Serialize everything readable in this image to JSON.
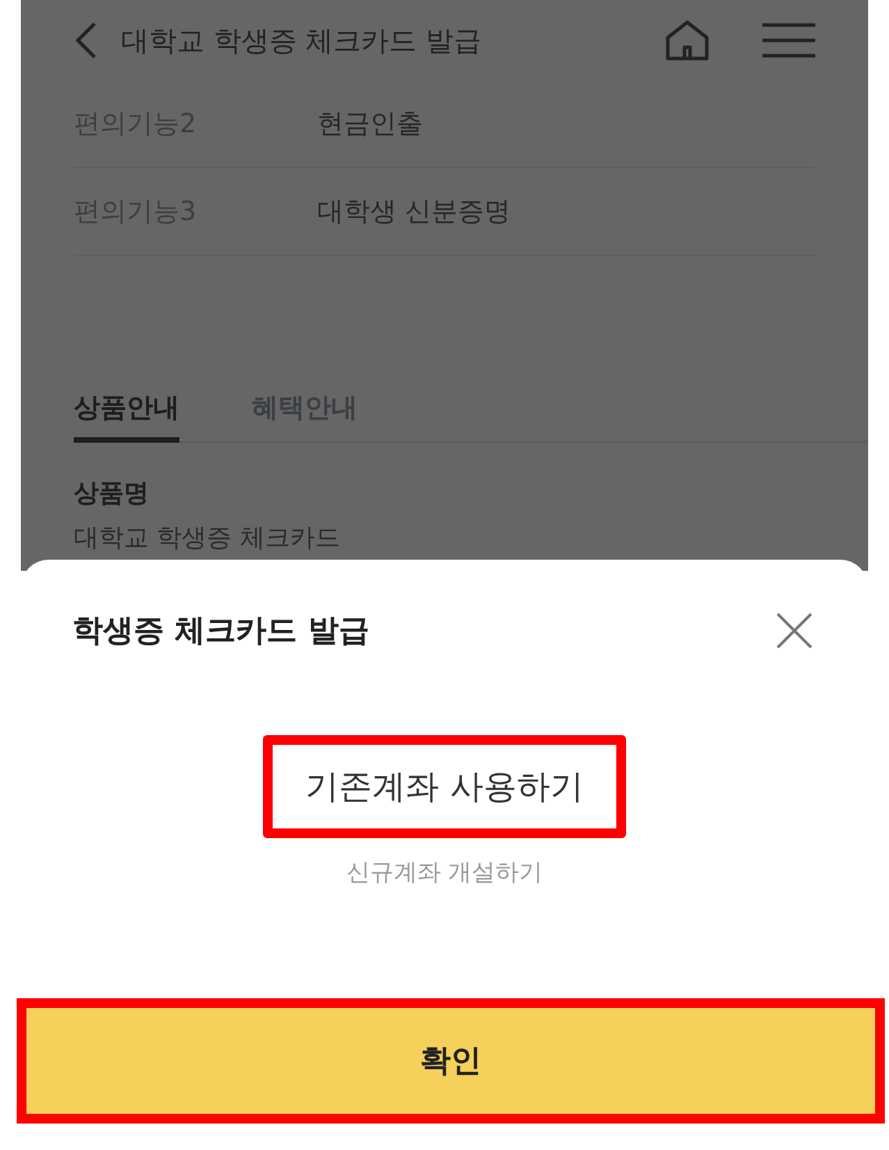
{
  "header": {
    "title": "대학교 학생증 체크카드 발급"
  },
  "features": [
    {
      "label": "편의기능2",
      "value": "현금인출"
    },
    {
      "label": "편의기능3",
      "value": "대학생 신분증명"
    }
  ],
  "tabs": [
    {
      "label": "상품안내",
      "selected": true
    },
    {
      "label": "혜택안내",
      "selected": false
    }
  ],
  "product": {
    "heading": "상품명",
    "name": "대학교 학생증 체크카드"
  },
  "sheet": {
    "title": "학생증 체크카드 발급",
    "options": [
      {
        "label": "기존계좌 사용하기",
        "selected": true,
        "highlighted": true
      },
      {
        "label": "신규계좌 개설하기",
        "selected": false,
        "highlighted": false
      }
    ],
    "confirm": {
      "label": "확인",
      "highlighted": true
    }
  }
}
